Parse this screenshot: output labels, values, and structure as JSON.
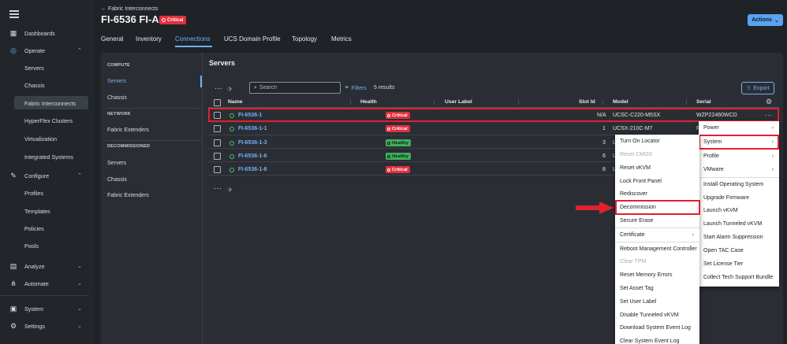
{
  "header": {
    "back_label": "← Fabric Interconnects",
    "title": "FI-6536 FI-A",
    "status_badge": "Critical",
    "actions_label": "Actions"
  },
  "tabs": [
    "General",
    "Inventory",
    "Connections",
    "UCS Domain Profile",
    "Topology",
    "Metrics"
  ],
  "active_tab": "Connections",
  "sidebar": {
    "dashboards": "Dashboards",
    "operate": "Operate",
    "operate_items": [
      "Servers",
      "Chassis",
      "Fabric Interconnects",
      "HyperFlex Clusters",
      "Virtualization",
      "Integrated Systems"
    ],
    "configure": "Configure",
    "configure_items": [
      "Profiles",
      "Templates",
      "Policies",
      "Pools"
    ],
    "analyze": "Analyze",
    "automate": "Automate",
    "system": "System",
    "settings": "Settings"
  },
  "left_nav": {
    "compute_head": "COMPUTE",
    "compute_items": [
      "Servers",
      "Chassis"
    ],
    "network_head": "NETWORK",
    "network_items": [
      "Fabric Extenders"
    ],
    "decommissioned_head": "DECOMMISSIONED",
    "decommissioned_items": [
      "Servers",
      "Chassis",
      "Fabric Extenders"
    ]
  },
  "main": {
    "title": "Servers",
    "search_placeholder": "Search",
    "filters_label": "Filters",
    "results_label": "5 results",
    "export_label": "Export"
  },
  "table": {
    "columns": [
      "Name",
      "Health",
      "User Label",
      "Slot Id",
      "Model",
      "Serial"
    ],
    "rows": [
      {
        "name": "FI-6536-1",
        "health": "Critical",
        "slot": "N/A",
        "model": "UCSC-C220-M5SX",
        "serial": "WZP22460WCD"
      },
      {
        "name": "FI-6536-1-1",
        "health": "Critical",
        "slot": "1",
        "model": "UCSX-210C-M7",
        "serial": "F"
      },
      {
        "name": "FI-6536-1-3",
        "health": "Healthy",
        "slot": "3",
        "model": "L",
        "serial": ""
      },
      {
        "name": "FI-6536-1-6",
        "health": "Healthy",
        "slot": "6",
        "model": "L",
        "serial": ""
      },
      {
        "name": "FI-6536-1-8",
        "health": "Critical",
        "slot": "8",
        "model": "L",
        "serial": ""
      }
    ]
  },
  "context_menu_main": [
    "Power",
    "System",
    "Profile",
    "VMware",
    "Install Operating System",
    "Upgrade Firmware",
    "Launch vKVM",
    "Launch Tunneled vKVM",
    "Start Alarm Suppression",
    "Open TAC Case",
    "Set License Tier",
    "Collect Tech Support Bundle"
  ],
  "context_menu_system": [
    "Turn On Locator",
    "Reset CMOS",
    "Reset vKVM",
    "Lock Front Panel",
    "Rediscover",
    "Decommission",
    "Secure Erase",
    "Certificate",
    "Reboot Management Controller",
    "Clear TPM",
    "Reset Memory Errors",
    "Set Asset Tag",
    "Set User Label",
    "Disable Tunneled vKVM",
    "Download System Event Log",
    "Clear System Event Log"
  ],
  "colors": {
    "accent": "#72b0f4",
    "critical": "#e0303c",
    "healthy": "#3fae5a",
    "highlight": "#e0212e"
  }
}
